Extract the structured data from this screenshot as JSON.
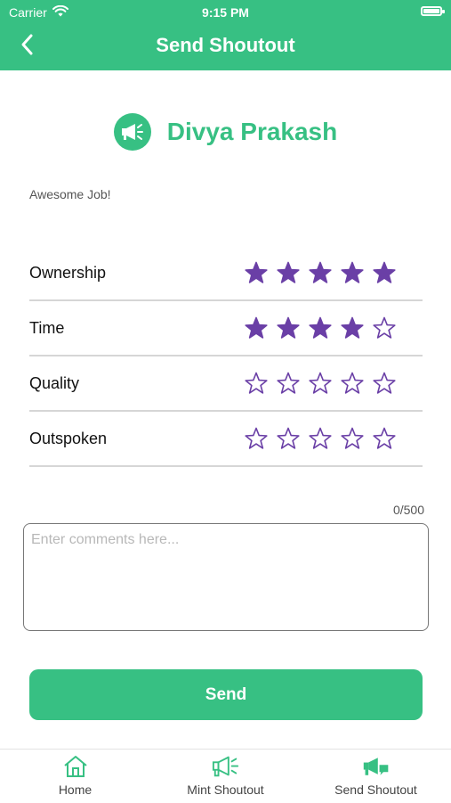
{
  "status_bar": {
    "carrier": "Carrier",
    "time": "9:15 PM",
    "battery_level": 1.0
  },
  "header": {
    "title": "Send Shoutout",
    "back_icon": "chevron-left-icon"
  },
  "recipient": {
    "name": "Divya Prakash",
    "icon": "megaphone-icon"
  },
  "subtitle": "Awesome Job!",
  "ratings": [
    {
      "label": "Ownership",
      "value": 5,
      "max": 5
    },
    {
      "label": "Time",
      "value": 4,
      "max": 5
    },
    {
      "label": "Quality",
      "value": 0,
      "max": 5
    },
    {
      "label": "Outspoken",
      "value": 0,
      "max": 5
    }
  ],
  "comments": {
    "counter": "0/500",
    "placeholder": "Enter comments here...",
    "value": ""
  },
  "send_button": {
    "label": "Send"
  },
  "tabs": [
    {
      "label": "Home",
      "icon": "home-icon"
    },
    {
      "label": "Mint Shoutout",
      "icon": "megaphone-outline-icon"
    },
    {
      "label": "Send Shoutout",
      "icon": "megaphone-filled-icon",
      "active": true
    }
  ],
  "colors": {
    "brand": "#37c083",
    "star": "#6a3fa6",
    "divider": "#d6d6d6"
  }
}
